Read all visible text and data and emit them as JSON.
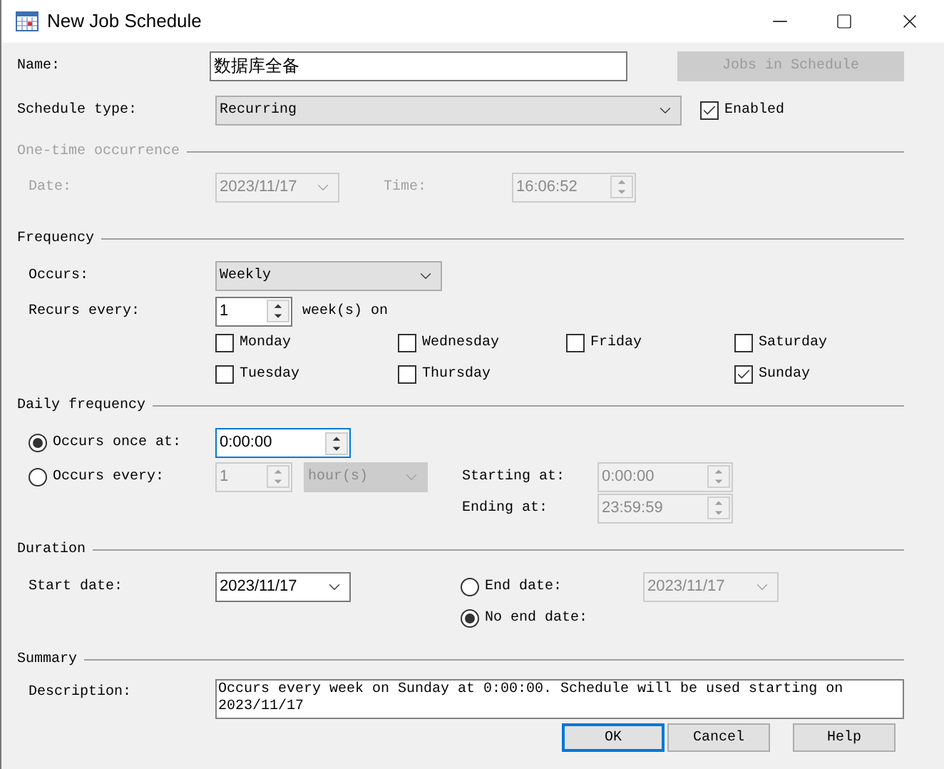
{
  "window": {
    "title": "New Job Schedule"
  },
  "name": {
    "label": "Name:",
    "value": "数据库全备"
  },
  "jobs_button": {
    "label": "Jobs in Schedule",
    "disabled": true
  },
  "schedule_type": {
    "label": "Schedule type:",
    "value": "Recurring"
  },
  "enabled": {
    "label": "Enabled",
    "checked": true
  },
  "one_time": {
    "title": "One-time occurrence",
    "disabled": true,
    "date_label": "Date:",
    "date": "2023/11/17",
    "time_label": "Time:",
    "time": "16:06:52"
  },
  "frequency": {
    "title": "Frequency",
    "occurs_label": "Occurs:",
    "occurs": "Weekly",
    "recurs_label": "Recurs every:",
    "recurs_value": "1",
    "recurs_unit": "week(s) on",
    "day_columns": [
      [
        {
          "label": "Monday",
          "checked": false
        },
        {
          "label": "Tuesday",
          "checked": false
        }
      ],
      [
        {
          "label": "Wednesday",
          "checked": false
        },
        {
          "label": "Thursday",
          "checked": false
        }
      ],
      [
        {
          "label": "Friday",
          "checked": false
        }
      ],
      [
        {
          "label": "Saturday",
          "checked": false
        },
        {
          "label": "Sunday",
          "checked": true
        }
      ]
    ]
  },
  "daily_frequency": {
    "title": "Daily frequency",
    "options": [
      {
        "label": "Occurs once at:",
        "selected": true
      },
      {
        "label": "Occurs every:",
        "selected": false
      }
    ],
    "once_time": "0:00:00",
    "every_value": "1",
    "every_unit": "hour(s)",
    "starting_label": "Starting at:",
    "starting": "0:00:00",
    "ending_label": "Ending at:",
    "ending": "23:59:59"
  },
  "duration": {
    "title": "Duration",
    "start_label": "Start date:",
    "start_date": "2023/11/17",
    "end_options": [
      {
        "label": "End date:",
        "selected": false
      },
      {
        "label": "No end date:",
        "selected": true
      }
    ],
    "end_date": "2023/11/17"
  },
  "summary": {
    "title": "Summary",
    "description_label": "Description:",
    "description": "Occurs every week on Sunday at 0:00:00. Schedule will be used starting on 2023/11/17"
  },
  "buttons": [
    {
      "label": "OK",
      "default": true
    },
    {
      "label": "Cancel",
      "default": false
    },
    {
      "label": "Help",
      "default": false
    }
  ]
}
